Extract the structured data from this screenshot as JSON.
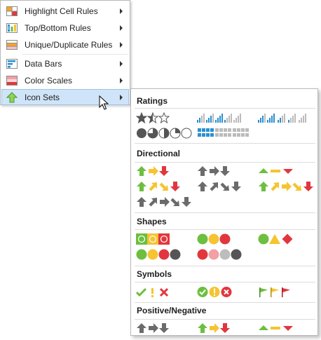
{
  "menu": {
    "items": [
      {
        "label": "Highlight Cell Rules",
        "icon": "highlight-cell-rules-icon"
      },
      {
        "label": "Top/Bottom Rules",
        "icon": "top-bottom-rules-icon"
      },
      {
        "label": "Unique/Duplicate Rules",
        "icon": "unique-duplicate-rules-icon"
      },
      {
        "label": "Data Bars",
        "icon": "data-bars-icon"
      },
      {
        "label": "Color Scales",
        "icon": "color-scales-icon"
      },
      {
        "label": "Icon Sets",
        "icon": "icon-sets-icon",
        "selected": true
      }
    ]
  },
  "submenu": {
    "sections": [
      {
        "title": "Ratings"
      },
      {
        "title": "Directional"
      },
      {
        "title": "Shapes"
      },
      {
        "title": "Symbols"
      },
      {
        "title": "Positive/Negative"
      }
    ]
  },
  "colors": {
    "green": "#6cbf3f",
    "yellow": "#f5c431",
    "red": "#e2363e",
    "gray": "#6b6b6b",
    "blue": "#2a8fd0",
    "selection": "#cfe4f8"
  }
}
